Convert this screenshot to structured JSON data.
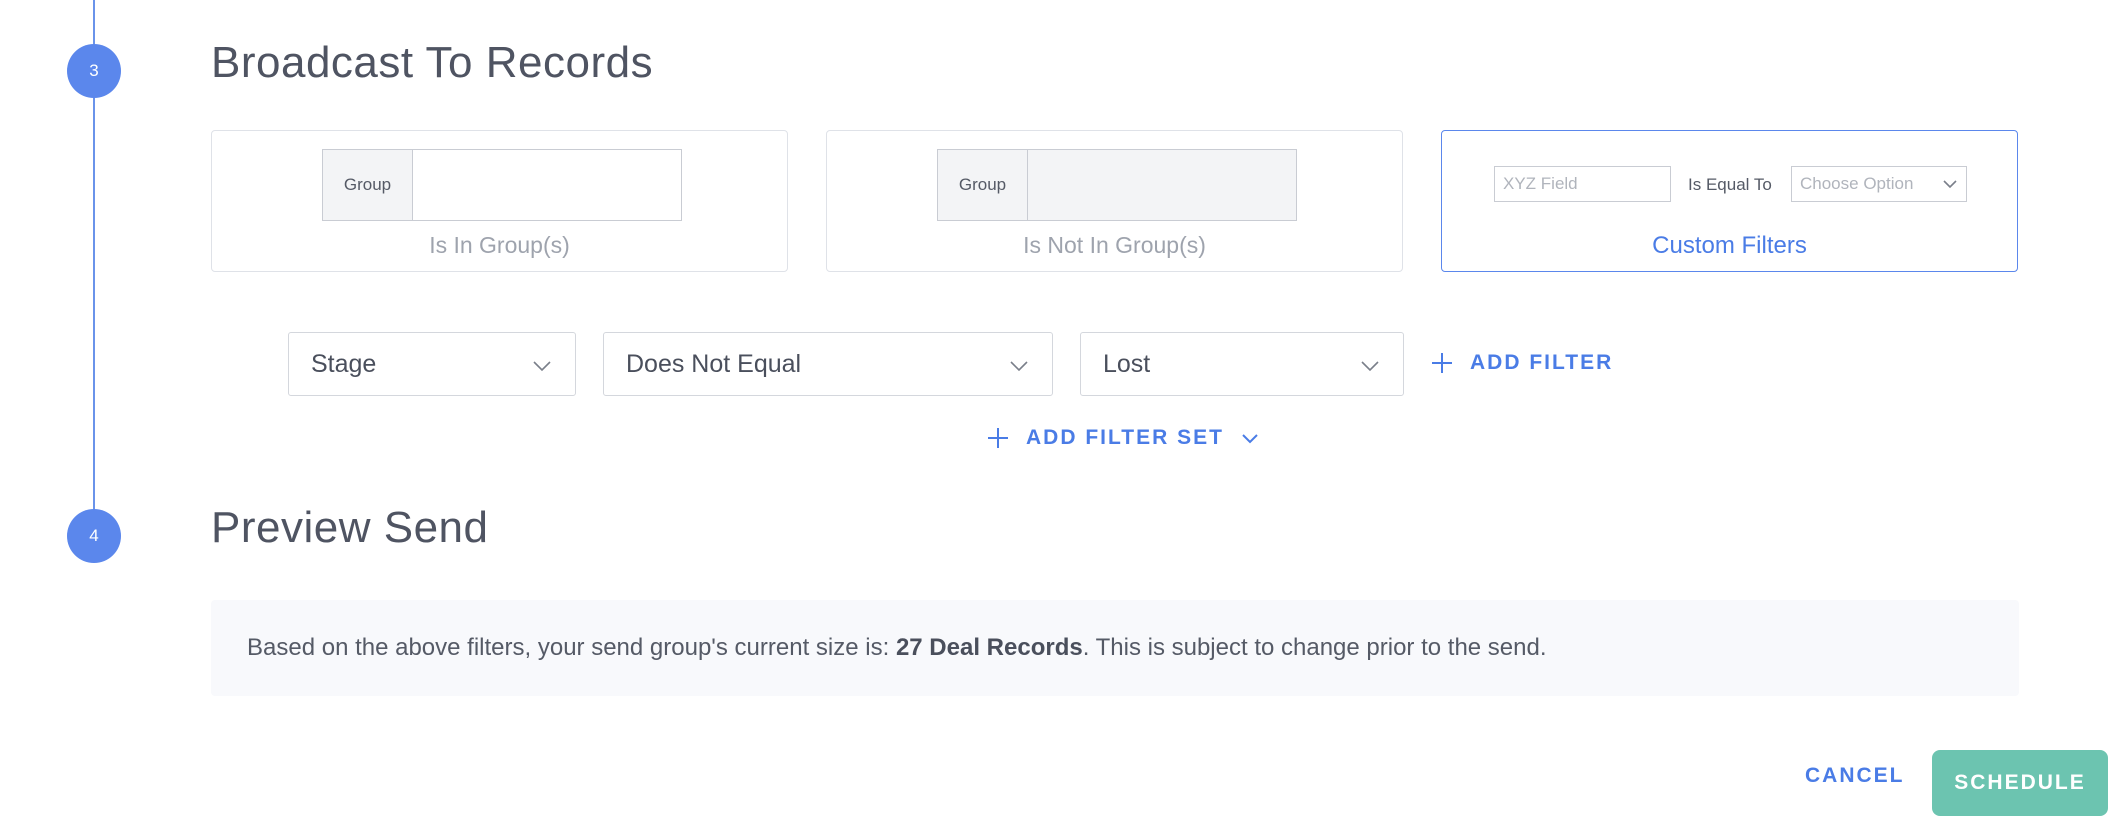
{
  "steps": {
    "step3": {
      "number": "3",
      "title": "Broadcast To Records"
    },
    "step4": {
      "number": "4",
      "title": "Preview Send"
    }
  },
  "audience_cards": {
    "in_group": {
      "group_label": "Group",
      "caption": "Is In Group(s)"
    },
    "not_in_group": {
      "group_label": "Group",
      "caption": "Is Not In Group(s)"
    },
    "custom": {
      "field_placeholder": "XYZ Field",
      "operator_label": "Is Equal To",
      "option_placeholder": "Choose Option",
      "caption": "Custom Filters",
      "selected": true
    }
  },
  "filter": {
    "field": "Stage",
    "operator": "Does Not Equal",
    "value": "Lost",
    "add_filter_label": "ADD FILTER",
    "add_filter_set_label": "ADD FILTER SET"
  },
  "preview": {
    "prefix": "Based on the above filters, your send group's current size is: ",
    "count": "27 Deal Records",
    "suffix": ". This is subject to change prior to the send."
  },
  "actions": {
    "cancel": "CANCEL",
    "schedule": "SCHEDULE"
  },
  "colors": {
    "accent": "#5b87ec",
    "link": "#4a7ce6",
    "schedule": "#6cc4b0"
  }
}
